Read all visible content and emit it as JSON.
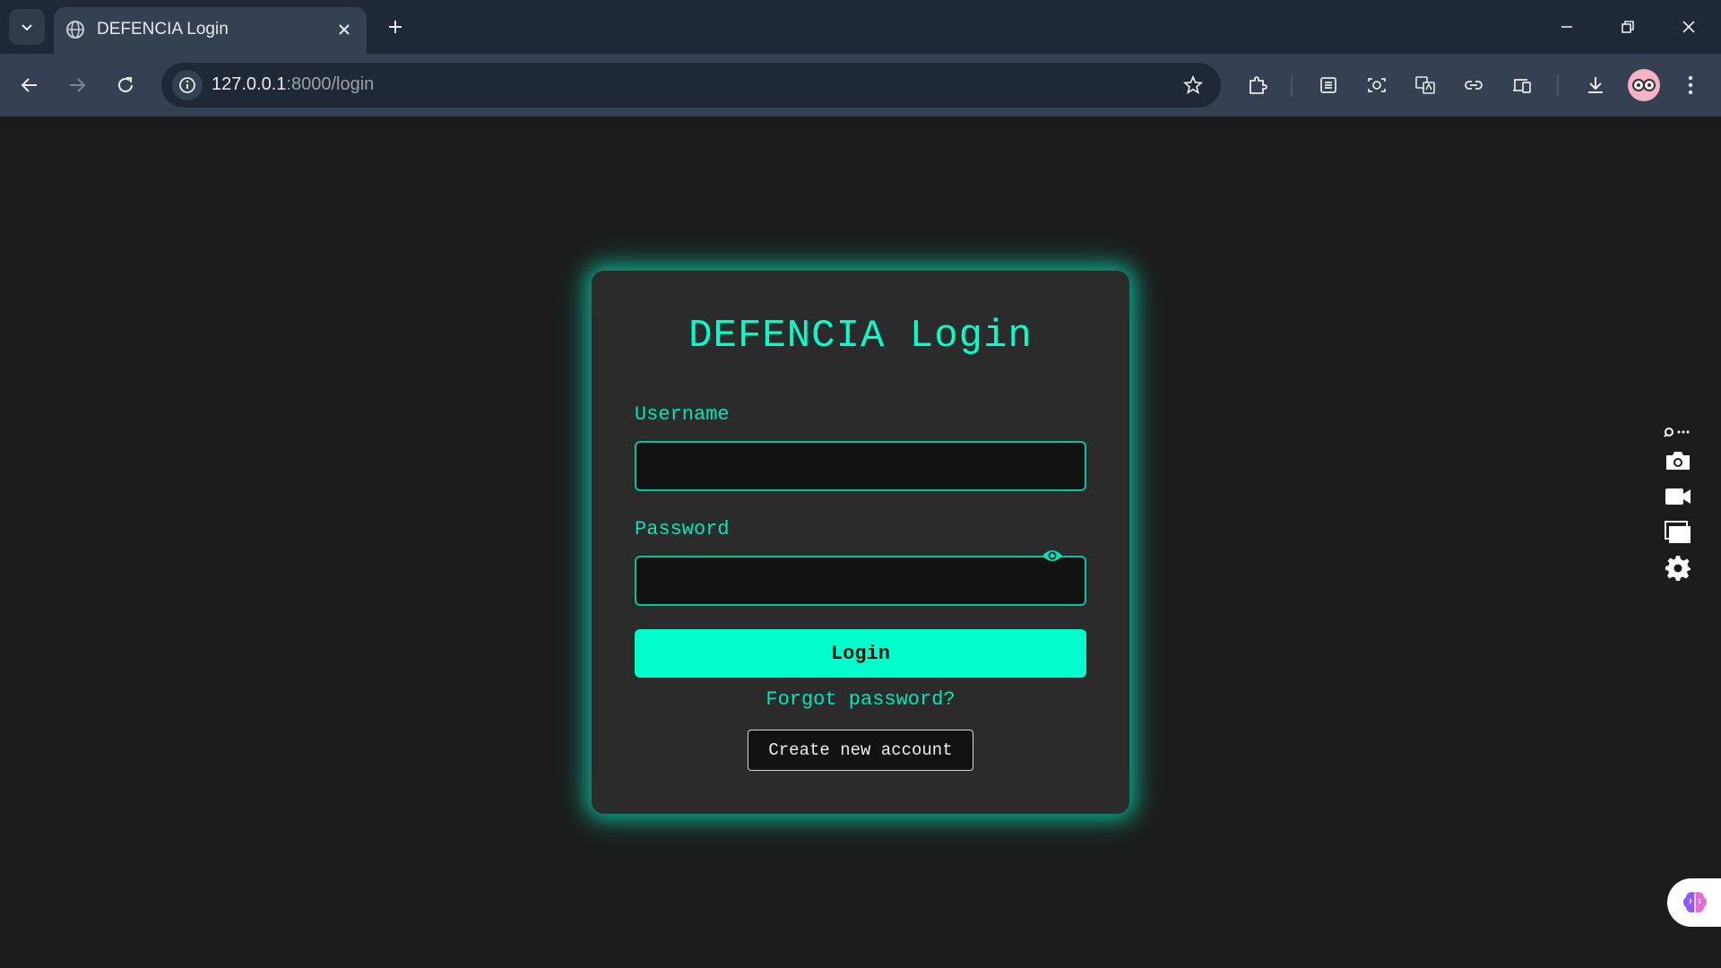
{
  "browser": {
    "tab": {
      "title": "DEFENCIA Login",
      "favicon": "globe-icon"
    },
    "url": {
      "host": "127.0.0.1",
      "path": ":8000/login"
    },
    "colors": {
      "tabbar": "#1f2837",
      "toolbar": "#354052"
    }
  },
  "login_card": {
    "title": "DEFENCIA Login",
    "username": {
      "label": "Username",
      "value": "",
      "placeholder": ""
    },
    "password": {
      "label": "Password",
      "value": "",
      "placeholder": ""
    },
    "login_button": "Login",
    "forgot_link": "Forgot password?",
    "create_button": "Create new account"
  },
  "theme": {
    "accent": "#00ffcc",
    "card_bg": "#2b2b2b",
    "page_bg": "#1c1c1c"
  }
}
